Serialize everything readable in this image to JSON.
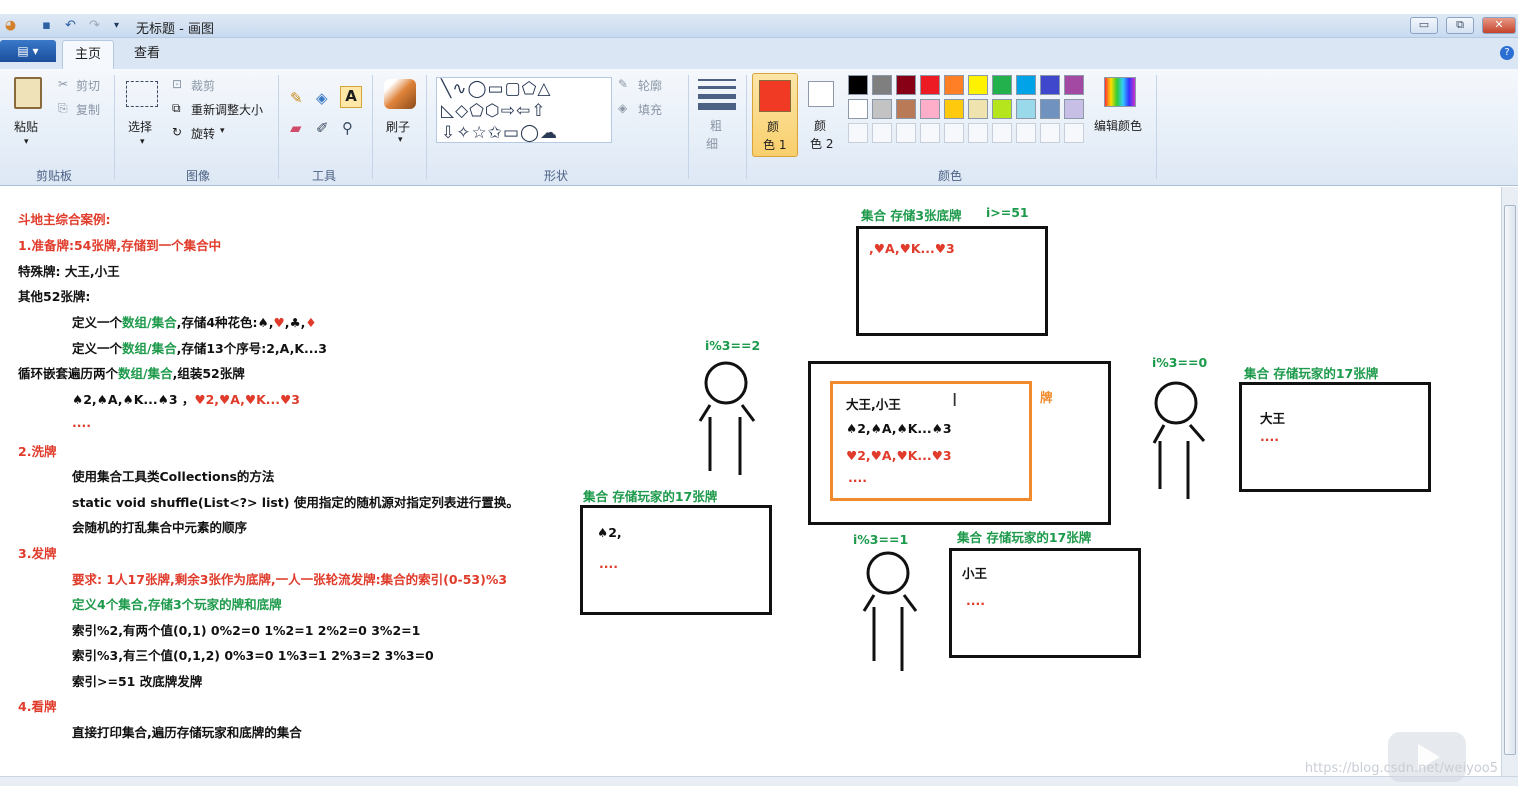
{
  "window": {
    "title": "无标题 - 画图",
    "minimize": "▭",
    "restore": "⧉",
    "close": "✕"
  },
  "tabs": {
    "app_menu": "▤ ▾",
    "home": "主页",
    "view": "查看"
  },
  "ribbon": {
    "clipboard": {
      "paste": "粘贴",
      "cut": "剪切",
      "copy": "复制",
      "group": "剪贴板"
    },
    "image": {
      "select": "选择",
      "crop": "裁剪",
      "resize": "重新调整大小",
      "rotate": "旋转",
      "group": "图像"
    },
    "tools": {
      "group": "工具"
    },
    "brushes": {
      "label": "刷子"
    },
    "shapes": {
      "outline": "轮廓",
      "fill": "填充",
      "group": "形状"
    },
    "size": {
      "label_1": "粗",
      "label_2": "细"
    },
    "colors": {
      "color1_a": "颜",
      "color1_b": "色 1",
      "color2_a": "颜",
      "color2_b": "色 2",
      "edit": "编辑颜色",
      "group": "颜色",
      "color1_value": "#f03a24",
      "color2_value": "#ffffff",
      "palette_row1": [
        "#000000",
        "#7f7f7f",
        "#880015",
        "#ed1c24",
        "#ff7f27",
        "#fff200",
        "#22b14c",
        "#00a2e8",
        "#3f48cc",
        "#a349a4"
      ],
      "palette_row2": [
        "#ffffff",
        "#c3c3c3",
        "#b97a57",
        "#ffaec9",
        "#ffc90e",
        "#efe4b0",
        "#b5e61d",
        "#99d9ea",
        "#7092be",
        "#c8bfe7"
      ]
    }
  },
  "notes": {
    "l1": "斗地主综合案例:",
    "l2": "1.准备牌:54张牌,存储到一个集合中",
    "l3": "特殊牌: 大王,小王",
    "l4": "其他52张牌:",
    "l5a": "定义一个",
    "l5b": "数组/集合",
    "l5c": ",存储4种花色:♠,",
    "l5d": "♥",
    "l5e": ",♣,",
    "l5f": "♦",
    "l6a": "定义一个",
    "l6b": "数组/集合",
    "l6c": ",存储13个序号:2,A,K...3",
    "l7a": "循环嵌套遍历两个",
    "l7b": "数组/集合",
    "l7c": ",组装52张牌",
    "l8a": "♠2,♠A,♠K...♠3 ，",
    "l8b": "♥2,♥A,♥K...♥3",
    "l9": "....",
    "l10": "2.洗牌",
    "l11": "使用集合工具类Collections的方法",
    "l12": "static void shuffle(List<?> list) 使用指定的随机源对指定列表进行置换。",
    "l13": "会随机的打乱集合中元素的顺序",
    "l14": "3.发牌",
    "l15": "要求: 1人17张牌,剩余3张作为底牌,一人一张轮流发牌:集合的索引(0-53)%3",
    "l16": "定义4个集合,存储3个玩家的牌和底牌",
    "l17": "索引%2,有两个值(0,1) 0%2=0 1%2=1 2%2=0 3%2=1",
    "l18": "索引%3,有三个值(0,1,2) 0%3=0 1%3=1 2%3=2 3%3=0",
    "l19": "索引>=51 改底牌发牌",
    "l20": "4.看牌",
    "l21": "直接打印集合,遍历存储玩家和底牌的集合"
  },
  "diagram": {
    "bottom_title": "集合 存储3张底牌",
    "bottom_cond": "i>=51",
    "bottom_content": ",♥A,♥K...♥3",
    "deck_line1": "大王,小王",
    "deck_line2": "♠2,♠A,♠K...♠3",
    "deck_line3": "♥2,♥A,♥K...♥3",
    "deck_line4": "....",
    "deck_label": "牌",
    "left_cond": "i%3==2",
    "left_title": "集合 存储玩家的17张牌",
    "left_line1": "♠2,",
    "left_line2": "....",
    "right_cond": "i%3==0",
    "right_title": "集合 存储玩家的17张牌",
    "right_line1": "大王",
    "right_line2": "....",
    "mid_cond": "i%3==1",
    "mid_title": "集合 存储玩家的17张牌",
    "mid_line1": "小王",
    "mid_line2": "...."
  },
  "watermark": "https://blog.csdn.net/weiyoo5"
}
